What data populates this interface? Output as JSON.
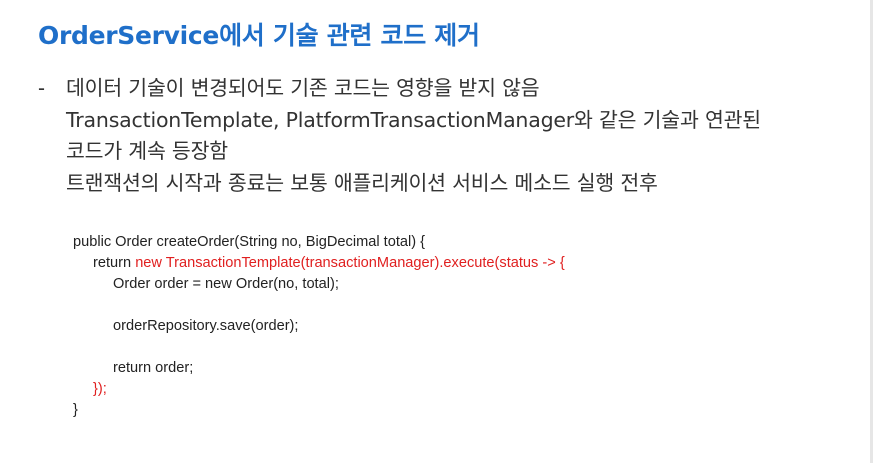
{
  "slide": {
    "title": "OrderService에서 기술 관련 코드 제거"
  },
  "bullet": {
    "marker": "-",
    "lines": [
      "데이터 기술이 변경되어도 기존 코드는 영향을 받지 않음",
      "TransactionTemplate, PlatformTransactionManager와 같은 기술과 연관된",
      "코드가 계속 등장함",
      "트랜잭션의 시작과 종료는 보통 애플리케이션 서비스 메소드 실행 전후"
    ]
  },
  "code": {
    "line1": "public Order createOrder(String no, BigDecimal total) {",
    "line2_prefix": "return ",
    "line2_highlight": "new TransactionTemplate(transactionManager).execute(status -> {",
    "line3": "Order order = new Order(no, total);",
    "line4": "",
    "line5": "orderRepository.save(order);",
    "line6": "",
    "line7": "return order;",
    "line8_highlight": "});",
    "line9": "}"
  },
  "colors": {
    "title": "#1f6fc9",
    "body_text": "#333333",
    "code_text": "#222222",
    "code_highlight": "#e02020"
  }
}
